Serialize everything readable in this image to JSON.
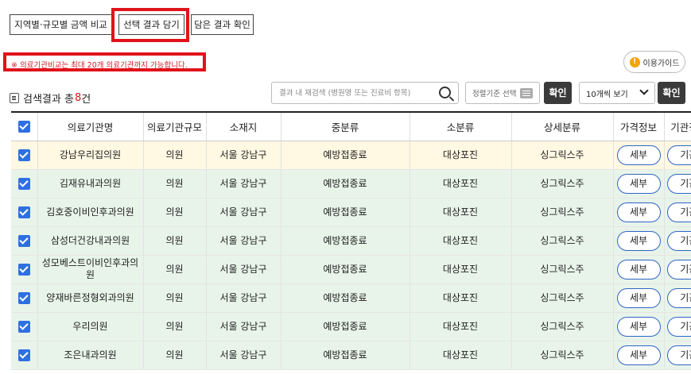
{
  "tabs": [
    {
      "label": "지역별·규모별 금액 비교"
    },
    {
      "label": "선택 결과 담기"
    },
    {
      "label": "담은 결과 확인"
    }
  ],
  "notice": "※ 의료기관비교는 최대 20개 의료기관까지 가능합니다.",
  "guide_button": {
    "label": "이용가이드",
    "icon": "!"
  },
  "result": {
    "prefix": "검색결과 총",
    "count": "8",
    "suffix": "건"
  },
  "search": {
    "placeholder": "결과 내 재검색 (병원명 또는 진료비 항목)",
    "value": ""
  },
  "sort_button": {
    "label": "정렬기준 선택"
  },
  "confirm_label": "확인",
  "page_size": {
    "selected": "10개씩 보기"
  },
  "table": {
    "headers": [
      "의료기관명",
      "의료기관규모",
      "소재지",
      "중분류",
      "소분류",
      "상세분류",
      "가격정보",
      "기관정보"
    ],
    "detail_label": "세부",
    "org_label": "기관",
    "rows": [
      {
        "name": "강남우리집의원",
        "size": "의원",
        "location": "서울 강남구",
        "mid": "예방접종료",
        "small": "대상포진",
        "detail": "싱그릭스주"
      },
      {
        "name": "김재유내과의원",
        "size": "의원",
        "location": "서울 강남구",
        "mid": "예방접종료",
        "small": "대상포진",
        "detail": "싱그릭스주"
      },
      {
        "name": "김호중이비인후과의원",
        "size": "의원",
        "location": "서울 강남구",
        "mid": "예방접종료",
        "small": "대상포진",
        "detail": "싱그릭스주"
      },
      {
        "name": "삼성더건강내과의원",
        "size": "의원",
        "location": "서울 강남구",
        "mid": "예방접종료",
        "small": "대상포진",
        "detail": "싱그릭스주"
      },
      {
        "name": "성모베스트이비인후과의원",
        "size": "의원",
        "location": "서울 강남구",
        "mid": "예방접종료",
        "small": "대상포진",
        "detail": "싱그릭스주"
      },
      {
        "name": "양재바른정형외과의원",
        "size": "의원",
        "location": "서울 강남구",
        "mid": "예방접종료",
        "small": "대상포진",
        "detail": "싱그릭스주"
      },
      {
        "name": "우리의원",
        "size": "의원",
        "location": "서울 강남구",
        "mid": "예방접종료",
        "small": "대상포진",
        "detail": "싱그릭스주"
      },
      {
        "name": "조은내과의원",
        "size": "의원",
        "location": "서울 강남구",
        "mid": "예방접종료",
        "small": "대상포진",
        "detail": "싱그릭스주"
      }
    ]
  },
  "colors": {
    "highlight": "#e0131b",
    "checkbox": "#2f6fe3",
    "row_first": "#fff8e2",
    "row_selected": "#e8f4ea"
  }
}
